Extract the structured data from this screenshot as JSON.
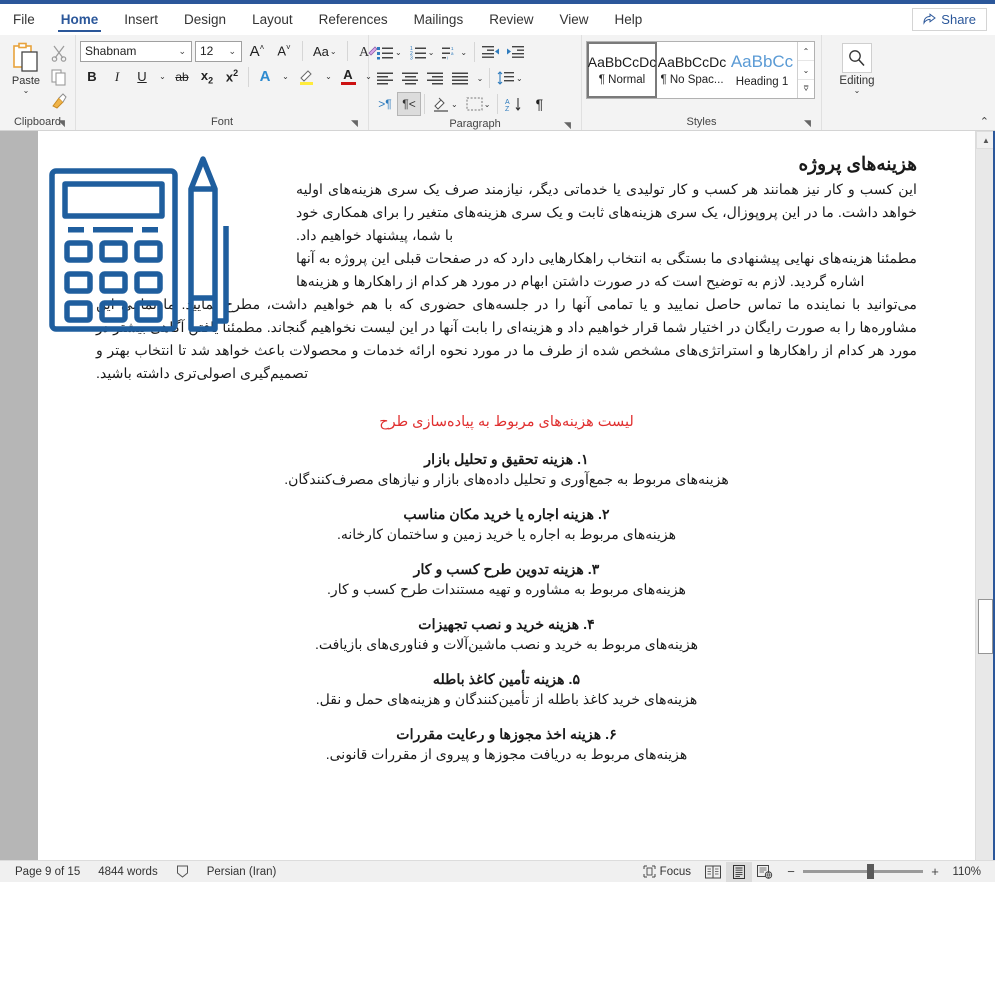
{
  "app": {
    "share_label": "Share",
    "share_icon": "share-icon"
  },
  "tabs": [
    {
      "label": "File",
      "active": false
    },
    {
      "label": "Home",
      "active": true
    },
    {
      "label": "Insert",
      "active": false
    },
    {
      "label": "Design",
      "active": false
    },
    {
      "label": "Layout",
      "active": false
    },
    {
      "label": "References",
      "active": false
    },
    {
      "label": "Mailings",
      "active": false
    },
    {
      "label": "Review",
      "active": false
    },
    {
      "label": "View",
      "active": false
    },
    {
      "label": "Help",
      "active": false
    }
  ],
  "ribbon": {
    "clipboard": {
      "label": "Clipboard",
      "paste_label": "Paste",
      "cut_icon": "scissors-icon",
      "copy_icon": "copy-icon",
      "format_painter_icon": "format-painter-icon",
      "launcher_icon": "dialog-launcher-icon"
    },
    "font": {
      "label": "Font",
      "font_name": "Shabnam",
      "font_size": "12",
      "grow_font_icon": "grow-font-icon",
      "shrink_font_icon": "shrink-font-icon",
      "change_case_label": "Aa",
      "clear_formatting_icon": "clear-formatting-icon",
      "bold_label": "B",
      "italic_label": "I",
      "underline_label": "U",
      "strikethrough_label": "ab",
      "subscript_label": "x",
      "superscript_label": "x",
      "text_effects_label": "A",
      "highlight_label": "highlight-icon",
      "font_color_label": "A",
      "launcher_icon": "dialog-launcher-icon"
    },
    "paragraph": {
      "label": "Paragraph",
      "bullets_icon": "bullets-icon",
      "numbering_icon": "numbering-icon",
      "multilevel_icon": "multilevel-list-icon",
      "decrease_indent_icon": "decrease-indent-icon",
      "increase_indent_icon": "increase-indent-icon",
      "align_left_icon": "align-left-icon",
      "align_center_icon": "align-center-icon",
      "align_right_icon": "align-right-icon",
      "justify_icon": "justify-icon",
      "line_spacing_icon": "line-spacing-icon",
      "ltr_icon": "left-to-right-icon",
      "rtl_icon": "right-to-left-icon",
      "shading_icon": "shading-icon",
      "borders_icon": "borders-icon",
      "sort_icon": "sort-icon",
      "show_marks_icon": "show-paragraph-marks-icon",
      "launcher_icon": "dialog-launcher-icon"
    },
    "styles": {
      "label": "Styles",
      "items": [
        {
          "preview": "AaBbCcDc",
          "name": "¶ Normal",
          "selected": true
        },
        {
          "preview": "AaBbCcDc",
          "name": "¶ No Spac...",
          "selected": false
        },
        {
          "preview": "AaBbCc",
          "name": "Heading 1",
          "selected": false
        }
      ],
      "scroll_up_icon": "chevron-up-icon",
      "scroll_down_icon": "chevron-down-icon",
      "more_icon": "styles-more-icon",
      "launcher_icon": "dialog-launcher-icon"
    },
    "editing": {
      "label": "Editing",
      "icon": "search-icon",
      "caret_icon": "chevron-down-icon"
    },
    "collapse_icon": "chevron-up-icon"
  },
  "document": {
    "title": "هزینه‌های پروژه",
    "paragraphs": [
      "این کسب و کار نیز همانند هر کسب و کار تولیدی یا خدماتی دیگر، نیازمند صرف یک سری هزینه‌های اولیه خواهد داشت. ما در این پروپوزال، یک سری هزینه‌های ثابت و یک سری هزینه‌های متغیر را برای همکاری خود با شما، پیشنهاد خواهیم داد.",
      "مطمئنا هزینه‌های نهایی پیشنهادی ما بستگی به انتخاب راهکارهایی دارد که در صفحات قبلی این پروژه به آنها اشاره گردید. لازم به توضیح است که در صورت داشتن ابهام در مورد هر کدام از راهکارها و هزینه‌ها",
      "می‌توانید با نماینده ما تماس حاصل نمایید و یا تمامی آنها را در جلسه‌های حضوری که با هم خواهیم داشت، مطرح نمایید. ما تمامی این مشاوره‌ها را به صورت رایگان در اختیار شما قرار خواهیم داد و هزینه‌ای را بابت آنها در این لیست نخواهیم گنجاند. مطمئنا یافتن آگاهی بیشتر در مورد هر کدام از راهکارها و استراتژی‌های مشخص شده از طرف ما در مورد نحوه ارائه خدمات و محصولات باعث خواهد شد تا انتخاب بهتر و تصمیم‌گیری اصولی‌تری داشته باشید."
    ],
    "subheading": "لیست هزینه‌های مربوط به پیاده‌سازی طرح",
    "illustration_name": "calculator-and-pencil-illustration",
    "illustration_color": "#1f5e9e",
    "list": [
      {
        "title": "۱. هزینه تحقیق و تحلیل بازار",
        "desc": "هزینه‌های مربوط به جمع‌آوری و تحلیل داده‌های بازار و نیازهای مصرف‌کنندگان."
      },
      {
        "title": "۲. هزینه اجاره یا خرید مکان مناسب",
        "desc": "هزینه‌های مربوط به اجاره یا خرید زمین و ساختمان کارخانه."
      },
      {
        "title": "۳. هزینه تدوین طرح کسب و کار",
        "desc": "هزینه‌های مربوط به مشاوره و تهیه مستندات طرح کسب و کار."
      },
      {
        "title": "۴. هزینه خرید و نصب تجهیزات",
        "desc": "هزینه‌های مربوط به خرید و نصب ماشین‌آلات و فناوری‌های بازیافت."
      },
      {
        "title": "۵. هزینه تأمین کاغذ باطله",
        "desc": "هزینه‌های خرید کاغذ باطله از تأمین‌کنندگان و هزینه‌های حمل و نقل."
      },
      {
        "title": "۶. هزینه اخذ مجوزها و رعایت مقررات",
        "desc": "هزینه‌های مربوط به دریافت مجوزها و پیروی از مقررات قانونی."
      }
    ]
  },
  "statusbar": {
    "page": "Page 9 of 15",
    "words": "4844 words",
    "proofing_icon": "proofing-errors-icon",
    "language": "Persian (Iran)",
    "focus_label": "Focus",
    "focus_icon": "focus-icon",
    "view_read_icon": "read-mode-icon",
    "view_print_icon": "print-layout-icon",
    "view_web_icon": "web-layout-icon",
    "zoom_out": "−",
    "zoom_in": "+",
    "zoom_level": "110%"
  }
}
